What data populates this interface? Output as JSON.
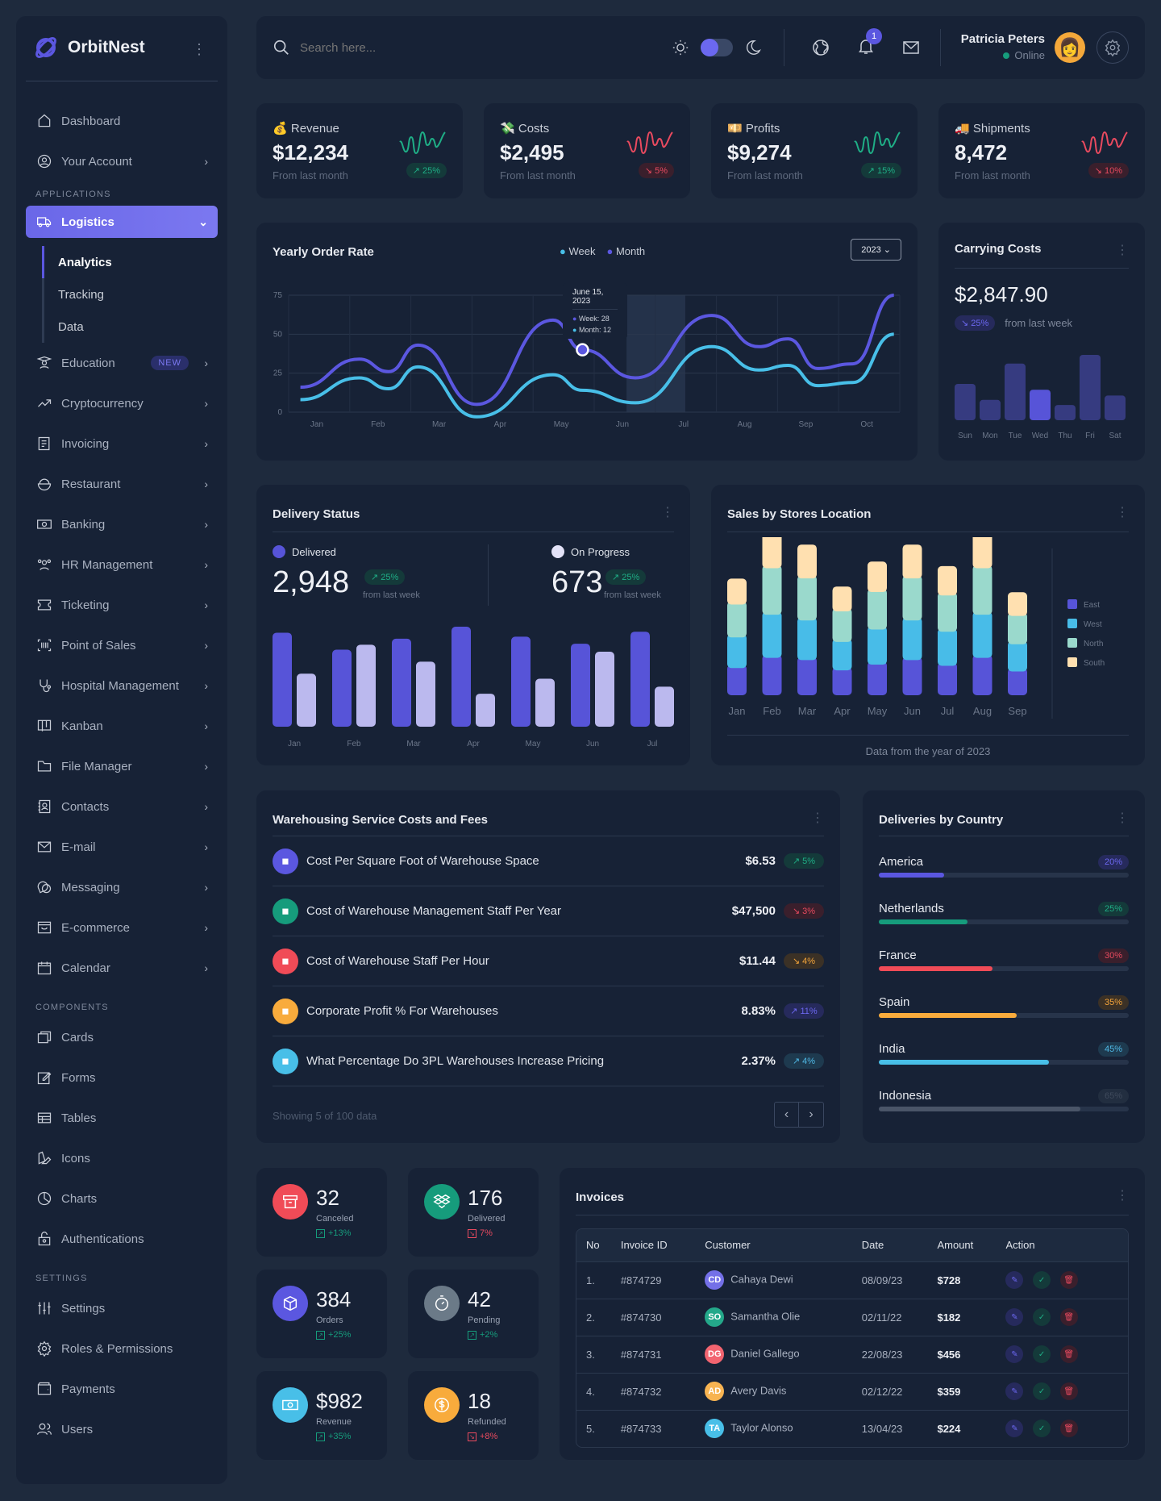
{
  "app": {
    "name": "OrbitNest"
  },
  "sidebar": {
    "top_items": [
      {
        "label": "Dashboard",
        "icon": "home-icon"
      },
      {
        "label": "Your Account",
        "icon": "user-circle-icon",
        "chevron": true
      }
    ],
    "applications_label": "APPLICATIONS",
    "active": {
      "label": "Logistics",
      "icon": "truck-icon",
      "sub": [
        "Analytics",
        "Tracking",
        "Data"
      ],
      "current": "Analytics"
    },
    "apps": [
      {
        "label": "Education",
        "icon": "graduation-cap-icon",
        "badge": "NEW"
      },
      {
        "label": "Cryptocurrency",
        "icon": "trend-up-icon"
      },
      {
        "label": "Invoicing",
        "icon": "invoice-icon"
      },
      {
        "label": "Restaurant",
        "icon": "bowl-icon"
      },
      {
        "label": "Banking",
        "icon": "banknote-icon"
      },
      {
        "label": "HR Management",
        "icon": "users-group-icon"
      },
      {
        "label": "Ticketing",
        "icon": "ticket-icon"
      },
      {
        "label": "Point of Sales",
        "icon": "barcode-icon"
      },
      {
        "label": "Hospital Management",
        "icon": "stethoscope-icon"
      },
      {
        "label": "Kanban",
        "icon": "kanban-icon"
      },
      {
        "label": "File Manager",
        "icon": "folder-icon"
      },
      {
        "label": "Contacts",
        "icon": "contact-book-icon"
      },
      {
        "label": "E-mail",
        "icon": "mail-icon"
      },
      {
        "label": "Messaging",
        "icon": "chat-icon"
      },
      {
        "label": "E-commerce",
        "icon": "shop-icon"
      },
      {
        "label": "Calendar",
        "icon": "calendar-icon"
      }
    ],
    "components_label": "COMPONENTS",
    "components": [
      {
        "label": "Cards",
        "icon": "cards-icon"
      },
      {
        "label": "Forms",
        "icon": "edit-icon"
      },
      {
        "label": "Tables",
        "icon": "table-icon"
      },
      {
        "label": "Icons",
        "icon": "swatch-icon"
      },
      {
        "label": "Charts",
        "icon": "chart-pie-icon"
      },
      {
        "label": "Authentications",
        "icon": "lock-icon"
      }
    ],
    "settings_label": "SETTINGS",
    "settings": [
      {
        "label": "Settings",
        "icon": "sliders-icon"
      },
      {
        "label": "Roles & Permissions",
        "icon": "gear-icon"
      },
      {
        "label": "Payments",
        "icon": "wallet-icon"
      },
      {
        "label": "Users",
        "icon": "users-icon"
      }
    ]
  },
  "topbar": {
    "search_placeholder": "Search here...",
    "notification_count": "1",
    "user_name": "Patricia Peters",
    "user_status": "Online"
  },
  "kpis": [
    {
      "emoji": "💰",
      "label": "Revenue",
      "value": "$12,234",
      "sub": "From last month",
      "change": "25%",
      "dir": "up",
      "color": "#1fae86"
    },
    {
      "emoji": "💸",
      "label": "Costs",
      "value": "$2,495",
      "sub": "From last month",
      "change": "5%",
      "dir": "down",
      "color": "#e84a5f"
    },
    {
      "emoji": "💴",
      "label": "Profits",
      "value": "$9,274",
      "sub": "From last month",
      "change": "15%",
      "dir": "up",
      "color": "#1fae86"
    },
    {
      "emoji": "🚚",
      "label": "Shipments",
      "value": "8,472",
      "sub": "From last month",
      "change": "10%",
      "dir": "down",
      "color": "#e84a5f"
    }
  ],
  "yearly": {
    "title": "Yearly Order Rate",
    "legend": [
      "Week",
      "Month"
    ],
    "year_select": "2023",
    "tooltip": {
      "date": "June 15, 2023",
      "week": "Week: 28",
      "month": "Month: 12"
    }
  },
  "carrying": {
    "title": "Carrying Costs",
    "value": "$2,847.90",
    "change": "25%",
    "sub": "from last week"
  },
  "delivery": {
    "title": "Delivery Status",
    "delivered_label": "Delivered",
    "delivered_value": "2,948",
    "delivered_change": "25%",
    "progress_label": "On Progress",
    "progress_value": "673",
    "progress_change": "25%",
    "sub": "from last week"
  },
  "sales": {
    "title": "Sales by Stores Location",
    "footer": "Data from the year of 2023"
  },
  "warehousing": {
    "title": "Warehousing Service Costs and Fees",
    "rows": [
      {
        "label": "Cost Per Square Foot of Warehouse Space",
        "value": "$6.53",
        "change": "5%",
        "cls": "g",
        "dir": "up",
        "color": "#5b57e0",
        "icon": "warehouse-icon"
      },
      {
        "label": "Cost of Warehouse Management Staff Per Year",
        "value": "$47,500",
        "change": "3%",
        "cls": "r",
        "dir": "down",
        "color": "#169c7c",
        "icon": "staff-icon"
      },
      {
        "label": "Cost of Warehouse Staff Per Hour",
        "value": "$11.44",
        "change": "4%",
        "cls": "o",
        "dir": "down",
        "color": "#f04b57",
        "icon": "people-icon"
      },
      {
        "label": "Corporate Profit % For Warehouses",
        "value": "8.83%",
        "change": "11%",
        "cls": "p",
        "dir": "up",
        "color": "#f8ab3c",
        "icon": "chart-icon"
      },
      {
        "label": "What Percentage Do 3PL Warehouses Increase Pricing",
        "value": "2.37%",
        "change": "4%",
        "cls": "b",
        "dir": "up",
        "color": "#48bfe8",
        "icon": "coin-icon"
      }
    ],
    "footer": "Showing 5 of 100 data"
  },
  "countries": {
    "title": "Deliveries by Country",
    "items": [
      {
        "name": "America",
        "pct": 20,
        "label": "20%",
        "color": "#5b57e0",
        "cls": "p",
        "fill": 0.26
      },
      {
        "name": "Netherlands",
        "pct": 25,
        "label": "25%",
        "color": "#169c7c",
        "cls": "g",
        "fill": 0.355
      },
      {
        "name": "France",
        "pct": 30,
        "label": "30%",
        "color": "#f04b57",
        "cls": "r",
        "fill": 0.455
      },
      {
        "name": "Spain",
        "pct": 35,
        "label": "35%",
        "color": "#f8ab3c",
        "cls": "o",
        "fill": 0.55
      },
      {
        "name": "India",
        "pct": 45,
        "label": "45%",
        "color": "#48bfe8",
        "cls": "b",
        "fill": 0.68
      },
      {
        "name": "Indonesia",
        "pct": 65,
        "label": "65%",
        "color": "#4a5568",
        "cls": "gray",
        "fill": 0.805
      }
    ]
  },
  "stats": [
    {
      "value": "32",
      "label": "Canceled",
      "change": "+13%",
      "dir": "up",
      "color": "#f04b57",
      "icon": "archive-icon"
    },
    {
      "value": "176",
      "label": "Delivered",
      "change": "7%",
      "dir": "down",
      "color": "#169c7c",
      "icon": "dropbox-icon"
    },
    {
      "value": "384",
      "label": "Orders",
      "change": "+25%",
      "dir": "up",
      "color": "#5b57e0",
      "icon": "box-icon"
    },
    {
      "value": "42",
      "label": "Pending",
      "change": "+2%",
      "dir": "up",
      "color": "#6b7a88",
      "icon": "stopwatch-icon"
    },
    {
      "value": "$982",
      "label": "Revenue",
      "change": "+35%",
      "dir": "up",
      "color": "#48bfe8",
      "icon": "banknote-icon"
    },
    {
      "value": "18",
      "label": "Refunded",
      "change": "+8%",
      "dir": "down",
      "color": "#f8ab3c",
      "icon": "dollar-coin-icon"
    }
  ],
  "invoices": {
    "title": "Invoices",
    "columns": [
      "No",
      "Invoice ID",
      "Customer",
      "Date",
      "Amount",
      "Action"
    ],
    "rows": [
      {
        "no": "1.",
        "id": "#874729",
        "initials": "CD",
        "customer": "Cahaya Dewi",
        "date": "08/09/23",
        "amount": "$728",
        "color": "#7470e8"
      },
      {
        "no": "2.",
        "id": "#874730",
        "initials": "SO",
        "customer": "Samantha Olie",
        "date": "02/11/22",
        "amount": "$182",
        "color": "#24a88a"
      },
      {
        "no": "3.",
        "id": "#874731",
        "initials": "DG",
        "customer": "Daniel Gallego",
        "date": "22/08/23",
        "amount": "$456",
        "color": "#f26470"
      },
      {
        "no": "4.",
        "id": "#874732",
        "initials": "AD",
        "customer": "Avery Davis",
        "date": "02/12/22",
        "amount": "$359",
        "color": "#f8b452"
      },
      {
        "no": "5.",
        "id": "#874733",
        "initials": "TA",
        "customer": "Taylor Alonso",
        "date": "13/04/23",
        "amount": "$224",
        "color": "#48bfe8"
      }
    ]
  },
  "chart_data": [
    {
      "type": "line",
      "title": "Yearly Order Rate",
      "x": [
        "Jan",
        "Feb",
        "Mar",
        "Apr",
        "May",
        "Jun",
        "Jul",
        "Aug",
        "Sep",
        "Oct"
      ],
      "ylim": [
        0,
        75
      ],
      "yticks": [
        0,
        25,
        50,
        75
      ],
      "highlight": "Jun",
      "series": [
        {
          "name": "Month",
          "color": "#5b57e0",
          "points": [
            [
              0.2,
              16
            ],
            [
              1.2,
              34
            ],
            [
              1.7,
              26
            ],
            [
              2.2,
              43
            ],
            [
              3.2,
              5
            ],
            [
              4.5,
              59
            ],
            [
              5.0,
              40
            ],
            [
              5.9,
              22
            ],
            [
              7.2,
              62
            ],
            [
              8.0,
              42
            ],
            [
              8.5,
              47
            ],
            [
              9.0,
              28
            ],
            [
              9.6,
              31
            ],
            [
              10.3,
              75
            ]
          ]
        },
        {
          "name": "Week",
          "color": "#48bfe8",
          "points": [
            [
              0.2,
              8
            ],
            [
              1.2,
              22
            ],
            [
              1.7,
              15
            ],
            [
              2.2,
              29
            ],
            [
              3.2,
              -3
            ],
            [
              4.5,
              24
            ],
            [
              5.0,
              14
            ],
            [
              5.9,
              6
            ],
            [
              7.2,
              42
            ],
            [
              8.0,
              27
            ],
            [
              8.5,
              30
            ],
            [
              9.0,
              17
            ],
            [
              9.6,
              19
            ],
            [
              10.3,
              50
            ]
          ]
        }
      ],
      "tooltip": {
        "date": "June 15, 2023",
        "Week": 28,
        "Month": 12
      }
    },
    {
      "type": "bar",
      "title": "Carrying Costs",
      "categories": [
        "Sun",
        "Mon",
        "Tue",
        "Wed",
        "Thu",
        "Fri",
        "Sat"
      ],
      "values": [
        50,
        28,
        78,
        42,
        21,
        90,
        34
      ],
      "highlight": "Wed"
    },
    {
      "type": "bar",
      "title": "Delivery Status",
      "categories": [
        "Jan",
        "Feb",
        "Mar",
        "Apr",
        "May",
        "Jun",
        "Jul"
      ],
      "series": [
        {
          "name": "Delivered",
          "color": "#5754d8",
          "values": [
            94,
            77,
            88,
            100,
            90,
            83,
            95
          ]
        },
        {
          "name": "On Progress",
          "color": "#bbb9ee",
          "values": [
            53,
            82,
            65,
            33,
            48,
            75,
            40
          ]
        }
      ]
    },
    {
      "type": "bar",
      "stacked": true,
      "title": "Sales by Stores Location",
      "categories": [
        "Jan",
        "Feb",
        "Mar",
        "Apr",
        "May",
        "Jun",
        "Jul",
        "Aug",
        "Sep"
      ],
      "legend": "right",
      "series": [
        {
          "name": "East",
          "color": "#5754d8",
          "values": [
            24,
            33,
            31,
            22,
            27,
            31,
            26,
            33,
            21
          ]
        },
        {
          "name": "West",
          "color": "#48bce8",
          "values": [
            27,
            38,
            35,
            25,
            31,
            35,
            30,
            38,
            24
          ]
        },
        {
          "name": "North",
          "color": "#9ad9cc",
          "values": [
            29,
            41,
            37,
            27,
            33,
            37,
            32,
            41,
            25
          ]
        },
        {
          "name": "South",
          "color": "#ffe0b0",
          "values": [
            20,
            29,
            27,
            19,
            24,
            27,
            23,
            29,
            18
          ]
        }
      ]
    }
  ]
}
